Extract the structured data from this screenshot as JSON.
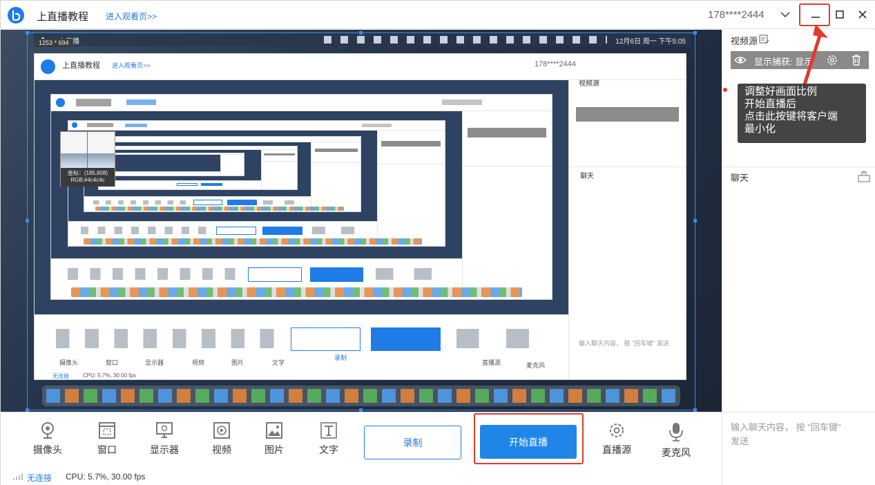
{
  "titlebar": {
    "title": "上直播教程",
    "watch_link": "进入观看页>>",
    "user_phone": "178****2444"
  },
  "preview": {
    "dimension_label": "1253 * 694",
    "mac_menubar": {
      "app_name": "上直播",
      "datetime": "12月6日 周一 下午5:05"
    },
    "nested": {
      "title": "上直播教程",
      "watch_link": "进入观看页>>",
      "user_phone": "178****2444",
      "video_source": "视频源",
      "source_label": "显示捕获: 显示",
      "chat_title": "聊天",
      "chat_placeholder": "输入聊天内容， 按 \"回车键\" 发送",
      "tools": [
        "摄像头",
        "窗口",
        "显示器",
        "视频",
        "图片",
        "文字"
      ],
      "record": "录制",
      "start_live": "开始直播",
      "live_source": "直播源",
      "microphone": "麦克风",
      "connection": "无连接",
      "cpu": "CPU: 5.7%,  30.00 fps"
    },
    "picker": {
      "coords": "坐标：(185,608)",
      "rgb": "RGB:#4c4c4c"
    }
  },
  "sidebar": {
    "video_source_title": "视频源",
    "source_item_label": "显示捕获: 显示",
    "chat_title": "聊天",
    "chat_placeholder_line1": "输入聊天内容， 按 \"回车键\"",
    "chat_placeholder_line2": "发送"
  },
  "annotation": {
    "line1": "调整好画面比例",
    "line2": "开始直播后",
    "line3": "点击此按键将客户端",
    "line4": "最小化"
  },
  "toolbar": {
    "camera": "摄像头",
    "window": "窗口",
    "display": "显示器",
    "video": "视频",
    "image": "图片",
    "text": "文字",
    "record": "录制",
    "start_live": "开始直播",
    "live_source": "直播源",
    "microphone": "麦克风"
  },
  "status": {
    "connection": "无连接",
    "cpu": "CPU: 5.7%,  30.00 fps"
  },
  "colors": {
    "accent": "#1f86e8",
    "highlight": "#e23a2b",
    "tooltip_bg": "#444444"
  }
}
